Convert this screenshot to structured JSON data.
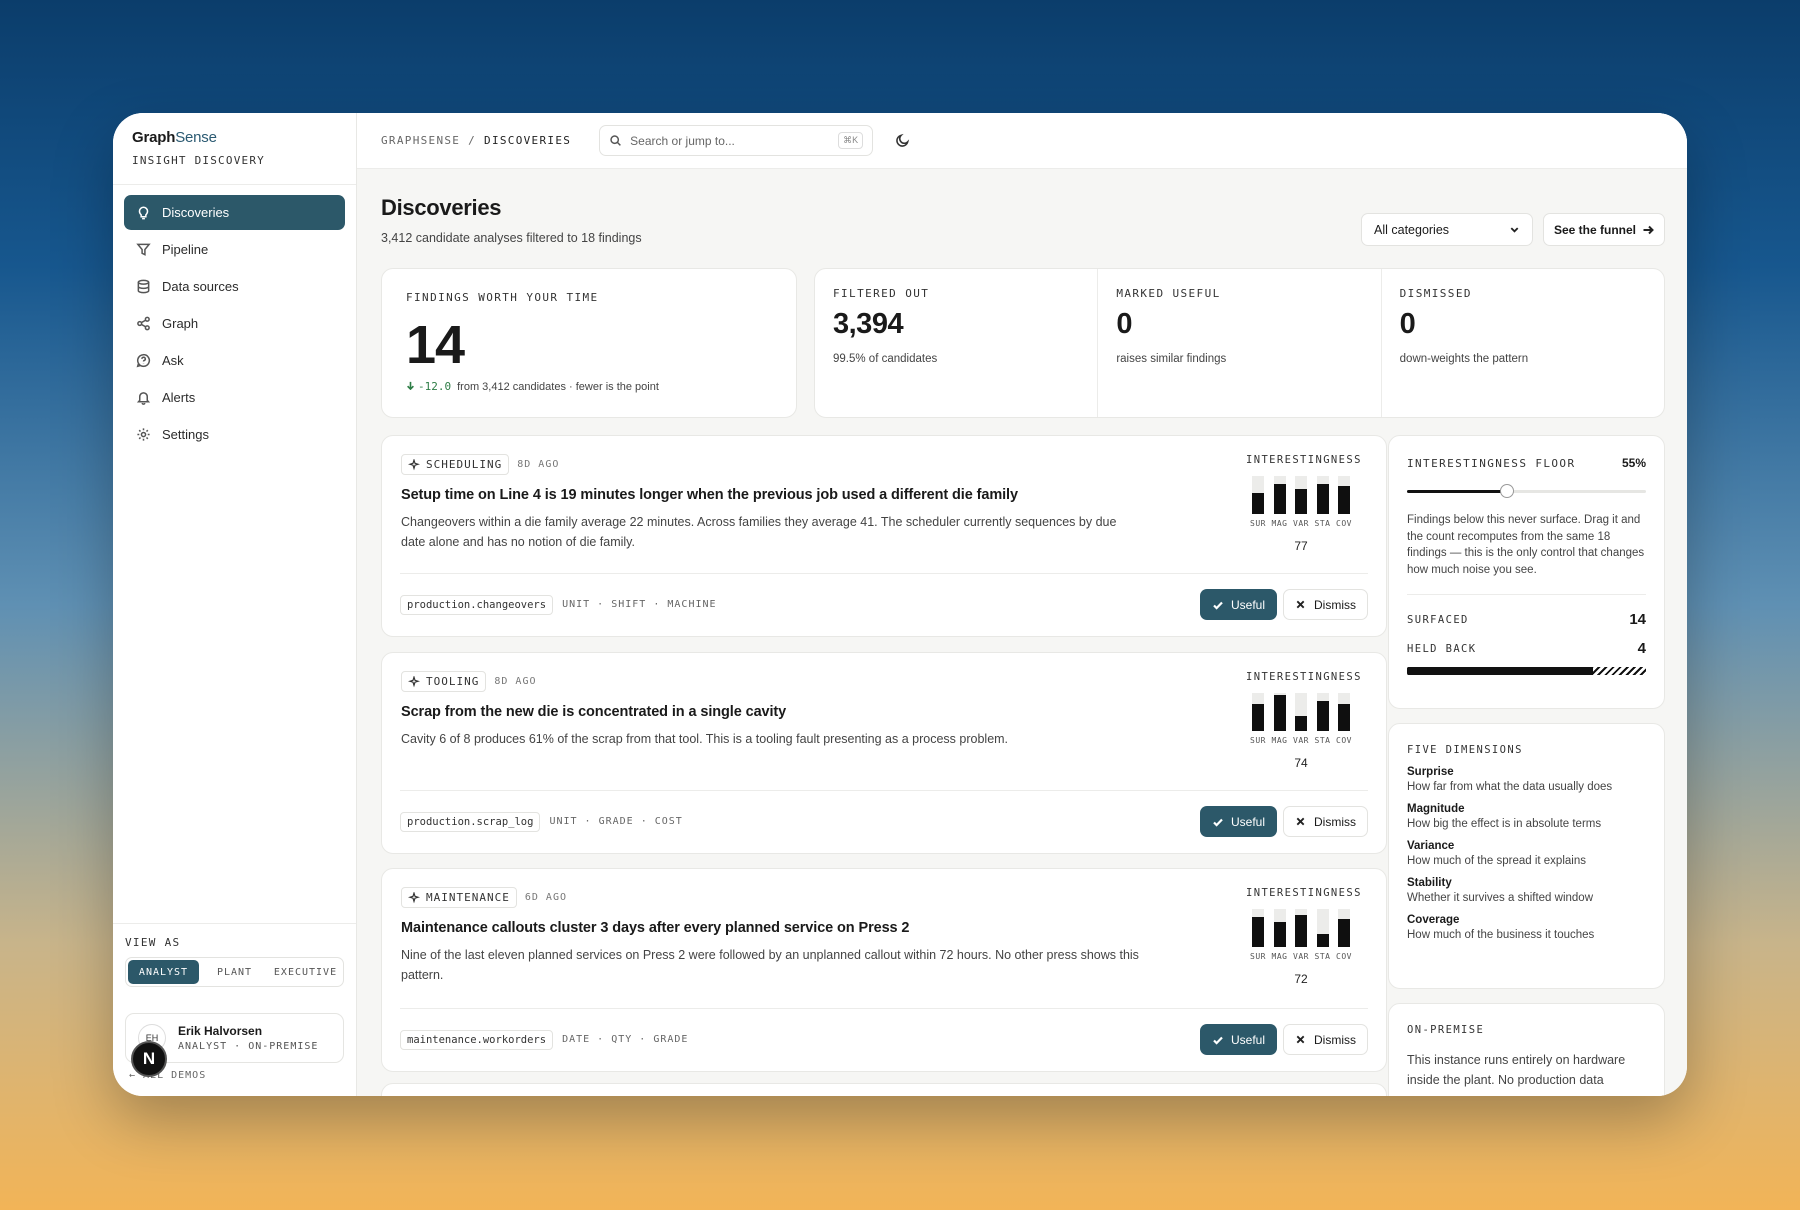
{
  "brand": {
    "name_a": "Graph",
    "name_b": "Sense",
    "subtitle": "INSIGHT DISCOVERY"
  },
  "nav": [
    {
      "label": "Discoveries",
      "icon": "lightbulb-icon",
      "active": true
    },
    {
      "label": "Pipeline",
      "icon": "filter-icon",
      "active": false
    },
    {
      "label": "Data sources",
      "icon": "database-icon",
      "active": false
    },
    {
      "label": "Graph",
      "icon": "share-nodes-icon",
      "active": false
    },
    {
      "label": "Ask",
      "icon": "question-circle-icon",
      "active": false
    },
    {
      "label": "Alerts",
      "icon": "bell-icon",
      "active": false
    },
    {
      "label": "Settings",
      "icon": "gear-icon",
      "active": false
    }
  ],
  "view_as": {
    "label": "VIEW AS",
    "options": [
      "ANALYST",
      "PLANT",
      "EXECUTIVE"
    ],
    "selected": "ANALYST"
  },
  "user": {
    "initials": "EH",
    "name": "Erik Halvorsen",
    "meta": "ANALYST · ON-PREMISE"
  },
  "all_demos": "← ALL DEMOS",
  "n_badge": "N",
  "topbar": {
    "crumb_root": "GRAPHSENSE",
    "crumb_sep": " / ",
    "crumb_page": "DISCOVERIES",
    "search_placeholder": "Search or jump to...",
    "search_shortcut": "⌘K"
  },
  "page": {
    "title": "Discoveries",
    "subtitle": "3,412 candidate analyses filtered to 18 findings",
    "category_select": "All categories",
    "funnel_button": "See the funnel"
  },
  "kpis": {
    "worth": {
      "label": "FINDINGS WORTH YOUR TIME",
      "value": "14",
      "delta": "-12.0",
      "delta_text": "from 3,412 candidates · fewer is the point"
    },
    "filtered": {
      "label": "FILTERED OUT",
      "value": "3,394",
      "sub": "99.5% of candidates"
    },
    "useful": {
      "label": "MARKED USEFUL",
      "value": "0",
      "sub": "raises similar findings"
    },
    "dismissed": {
      "label": "DISMISSED",
      "value": "0",
      "sub": "down-weights the pattern"
    }
  },
  "finding_labels": {
    "interest": "INTERESTINGNESS",
    "dims": [
      "SUR",
      "MAG",
      "VAR",
      "STA",
      "COV"
    ],
    "useful": "Useful",
    "dismiss": "Dismiss"
  },
  "findings": [
    {
      "category": "SCHEDULING",
      "ago": "8D AGO",
      "title": "Setup time on Line 4 is 19 minutes longer when the previous job used a different die family",
      "body": "Changeovers within a die family average 22 minutes. Across families they average 41. The scheduler currently sequences by due date alone and has no notion of die family.",
      "table": "production.changeovers",
      "columns": "UNIT · SHIFT · MACHINE",
      "score": "77",
      "dims": [
        0.55,
        0.8,
        0.65,
        0.8,
        0.75
      ]
    },
    {
      "category": "TOOLING",
      "ago": "8D AGO",
      "title": "Scrap from the new die is concentrated in a single cavity",
      "body": "Cavity 6 of 8 produces 61% of the scrap from that tool. This is a tooling fault presenting as a process problem.",
      "table": "production.scrap_log",
      "columns": "UNIT · GRADE · COST",
      "score": "74",
      "dims": [
        0.7,
        0.95,
        0.4,
        0.8,
        0.7
      ]
    },
    {
      "category": "MAINTENANCE",
      "ago": "6D AGO",
      "title": "Maintenance callouts cluster 3 days after every planned service on Press 2",
      "body": "Nine of the last eleven planned services on Press 2 were followed by an unplanned callout within 72 hours. No other press shows this pattern.",
      "table": "maintenance.workorders",
      "columns": "DATE · QTY · GRADE",
      "score": "72",
      "dims": [
        0.8,
        0.65,
        0.85,
        0.35,
        0.75
      ]
    }
  ],
  "floor": {
    "label": "INTERESTINGNESS FLOOR",
    "value": "55%",
    "level": 0.42,
    "note": "Findings below this never surface. Drag it and the count recomputes from the same 18 findings — this is the only control that changes how much noise you see.",
    "surfaced_label": "SURFACED",
    "surfaced": "14",
    "held_label": "HELD BACK",
    "held": "4",
    "surfaced_fraction": 0.78
  },
  "dimensions": {
    "label": "FIVE DIMENSIONS",
    "items": [
      {
        "name": "Surprise",
        "desc": "How far from what the data usually does"
      },
      {
        "name": "Magnitude",
        "desc": "How big the effect is in absolute terms"
      },
      {
        "name": "Variance",
        "desc": "How much of the spread it explains"
      },
      {
        "name": "Stability",
        "desc": "Whether it survives a shifted window"
      },
      {
        "name": "Coverage",
        "desc": "How much of the business it touches"
      }
    ]
  },
  "onprem": {
    "label": "ON-PREMISE",
    "text": "This instance runs entirely on hardware inside the plant. No production data"
  },
  "colors": {
    "accent": "#2c5869",
    "delta_green": "#2e7d46"
  }
}
